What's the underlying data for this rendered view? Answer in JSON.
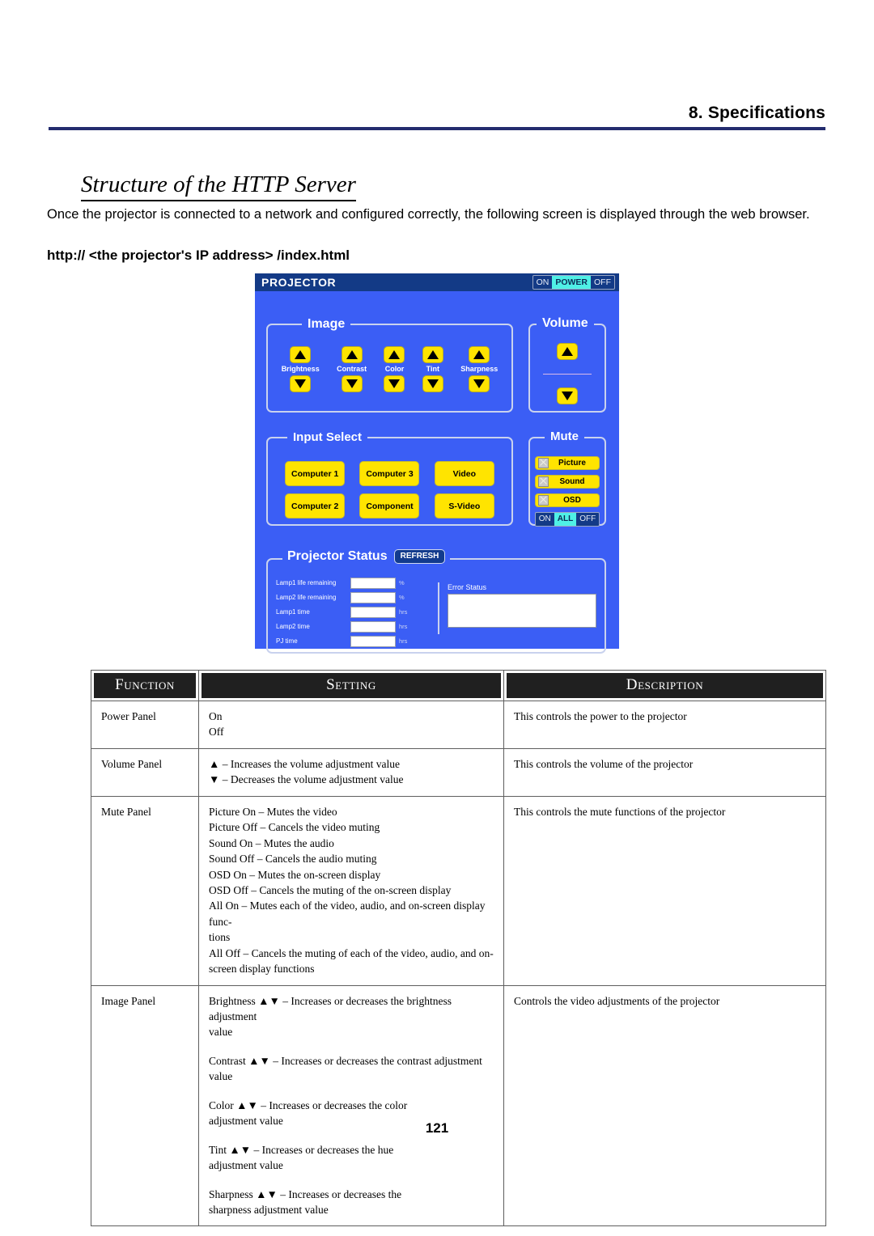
{
  "header": {
    "chapter": "8. Specifications"
  },
  "section": {
    "title": "Structure of the HTTP Server",
    "intro": "Once the projector is connected to a network and configured correctly, the following screen is displayed through the web browser.",
    "url": "http:// <the projector's IP address> /index.html"
  },
  "projector_ui": {
    "window_title": "PROJECTOR",
    "power_toggle": {
      "on": "ON",
      "label": "POWER",
      "off": "OFF"
    },
    "image": {
      "label": "Image",
      "adjustments": [
        "Brightness",
        "Contrast",
        "Color",
        "Tint",
        "Sharpness"
      ]
    },
    "volume": {
      "label": "Volume"
    },
    "input_select": {
      "label": "Input Select",
      "buttons": [
        "Computer 1",
        "Computer 3",
        "Video",
        "Computer 2",
        "Component",
        "S-Video"
      ]
    },
    "mute": {
      "label": "Mute",
      "items": [
        "Picture",
        "Sound",
        "OSD"
      ],
      "all_toggle": {
        "on": "ON",
        "label": "ALL",
        "off": "OFF"
      }
    },
    "status": {
      "label": "Projector Status",
      "refresh": "REFRESH",
      "rows": [
        {
          "label": "Lamp1 life remaining",
          "value": "",
          "unit": "%"
        },
        {
          "label": "Lamp2 life remaining",
          "value": "",
          "unit": "%"
        },
        {
          "label": "Lamp1 time",
          "value": "",
          "unit": "hrs"
        },
        {
          "label": "Lamp2 time",
          "value": "",
          "unit": "hrs"
        },
        {
          "label": "PJ time",
          "value": "",
          "unit": "hrs"
        }
      ],
      "error_status_label": "Error Status",
      "error_status_value": ""
    },
    "colors": {
      "panel_blue": "#3b5ef5",
      "titlebar_navy": "#133a86",
      "button_yellow": "#ffe400",
      "highlight_cyan": "#4ff0e6"
    }
  },
  "spec_table": {
    "headers": [
      "Function",
      "Setting",
      "Description"
    ],
    "rows": [
      {
        "function": "Power Panel",
        "setting": [
          "On",
          "Off"
        ],
        "description": "This controls the power to the projector"
      },
      {
        "function": "Volume Panel",
        "setting": [
          "▲ – Increases the volume adjustment value",
          "▼ – Decreases the volume adjustment value"
        ],
        "description": "This controls the volume of the projector"
      },
      {
        "function": "Mute Panel",
        "setting": [
          "Picture On – Mutes the video",
          "Picture Off – Cancels the video muting",
          "Sound On – Mutes the audio",
          "Sound Off – Cancels the audio muting",
          "OSD On – Mutes the on-screen display",
          "OSD Off – Cancels the muting of the on-screen display",
          "All On – Mutes each of the video, audio, and on-screen display func-",
          "tions",
          "All Off – Cancels the muting of each of the video, audio, and on-",
          "screen display functions"
        ],
        "description": "This controls the mute functions of the projector"
      },
      {
        "function": "Image Panel",
        "setting_blocks": [
          [
            "Brightness ▲▼ – Increases or decreases the brightness adjustment",
            "value"
          ],
          [
            "Contrast ▲▼ – Increases or decreases the contrast adjustment value"
          ],
          [
            "Color ▲▼ – Increases or decreases the color",
            "adjustment value"
          ],
          [
            "Tint ▲▼ – Increases or decreases the hue",
            "adjustment value"
          ],
          [
            "Sharpness ▲▼ – Increases or decreases the",
            "sharpness adjustment value"
          ]
        ],
        "description": "Controls the video adjustments of the projector"
      }
    ]
  },
  "page_number": "121"
}
